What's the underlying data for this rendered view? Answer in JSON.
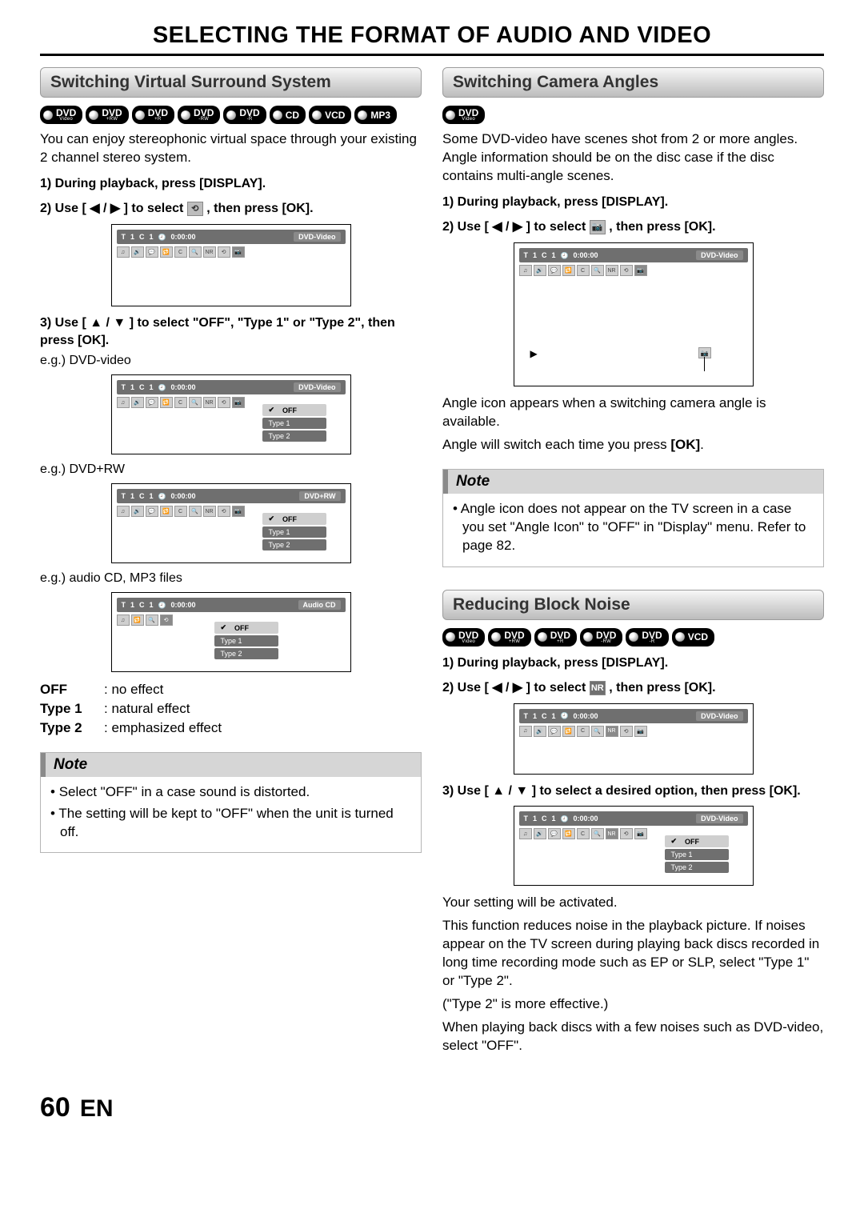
{
  "title": "SELECTING THE FORMAT OF AUDIO AND VIDEO",
  "footer": {
    "page": "60",
    "lang": "EN"
  },
  "left": {
    "heading": "Switching Virtual Surround System",
    "media": [
      {
        "main": "DVD",
        "sub": "Video"
      },
      {
        "main": "DVD",
        "sub": "+RW"
      },
      {
        "main": "DVD",
        "sub": "+R"
      },
      {
        "main": "DVD",
        "sub": "-RW"
      },
      {
        "main": "DVD",
        "sub": "-R"
      },
      {
        "main": "CD",
        "sub": ""
      },
      {
        "main": "VCD",
        "sub": ""
      },
      {
        "main": "MP3",
        "sub": ""
      }
    ],
    "intro": "You can enjoy stereophonic virtual space through your existing 2 channel stereo system.",
    "step1": "1) During playback, press [DISPLAY].",
    "step2_a": "2) Use [ ",
    "step2_arrows": "◀ / ▶",
    "step2_b": " ] to select ",
    "step2_icon": "⟲",
    "step2_c": " , then press [OK].",
    "step3": "3) Use [ ▲ / ▼ ] to select \"OFF\", \"Type 1\" or \"Type 2\", then press [OK].",
    "eg1": "e.g.) DVD-video",
    "eg2": "e.g.) DVD+RW",
    "eg3": "e.g.) audio CD, MP3 files",
    "osd": {
      "t": "T",
      "t_n": "1",
      "c": "C",
      "c_n": "1",
      "time": "0:00:00",
      "mode_dvdvideo": "DVD-Video",
      "mode_dvdrw": "DVD+RW",
      "mode_cd": "Audio CD",
      "opts": [
        "OFF",
        "Type 1",
        "Type 2"
      ]
    },
    "def_off_k": "OFF",
    "def_off_v": ": no effect",
    "def_t1_k": "Type 1",
    "def_t1_v": ": natural effect",
    "def_t2_k": "Type 2",
    "def_t2_v": ": emphasized effect",
    "note_title": "Note",
    "note_items": [
      "Select \"OFF\" in a case sound is distorted.",
      "The setting will be kept to \"OFF\" when the unit is turned off."
    ]
  },
  "right_top": {
    "heading": "Switching Camera Angles",
    "media": [
      {
        "main": "DVD",
        "sub": "Video"
      }
    ],
    "intro": "Some DVD-video have scenes shot from 2 or more angles. Angle information should be on the disc case if the disc contains multi-angle scenes.",
    "step1": "1) During playback, press [DISPLAY].",
    "step2_a": "2) Use [ ",
    "step2_arrows": "◀ / ▶",
    "step2_b": " ] to select ",
    "step2_icon": "📷",
    "step2_c": " , then press [OK].",
    "caption1": "Angle icon appears when a switching camera angle is available.",
    "caption2": "Angle will switch each time you press [OK].",
    "note_title": "Note",
    "note_items": [
      "Angle icon does not appear on the TV screen in a case you set \"Angle Icon\" to \"OFF\" in \"Display\" menu. Refer to page 82."
    ]
  },
  "right_bot": {
    "heading": "Reducing Block Noise",
    "media": [
      {
        "main": "DVD",
        "sub": "Video"
      },
      {
        "main": "DVD",
        "sub": "+RW"
      },
      {
        "main": "DVD",
        "sub": "+R"
      },
      {
        "main": "DVD",
        "sub": "-RW"
      },
      {
        "main": "DVD",
        "sub": "-R"
      },
      {
        "main": "VCD",
        "sub": ""
      }
    ],
    "step1": "1) During playback, press [DISPLAY].",
    "step2_a": "2) Use [ ",
    "step2_arrows": "◀ / ▶",
    "step2_b": " ] to select ",
    "step2_icon": "NR",
    "step2_c": " , then press [OK].",
    "step3": "3) Use [ ▲ / ▼ ] to select a desired option, then press [OK].",
    "after": "Your setting will be activated.",
    "para1": "This function reduces noise in the playback picture. If noises appear on the TV screen during playing back discs recorded in long time recording mode such as EP or SLP, select \"Type 1\" or \"Type 2\".",
    "para2": "(\"Type 2\" is more effective.)",
    "para3": "When playing back discs with a few noises such as DVD-video, select \"OFF\"."
  }
}
